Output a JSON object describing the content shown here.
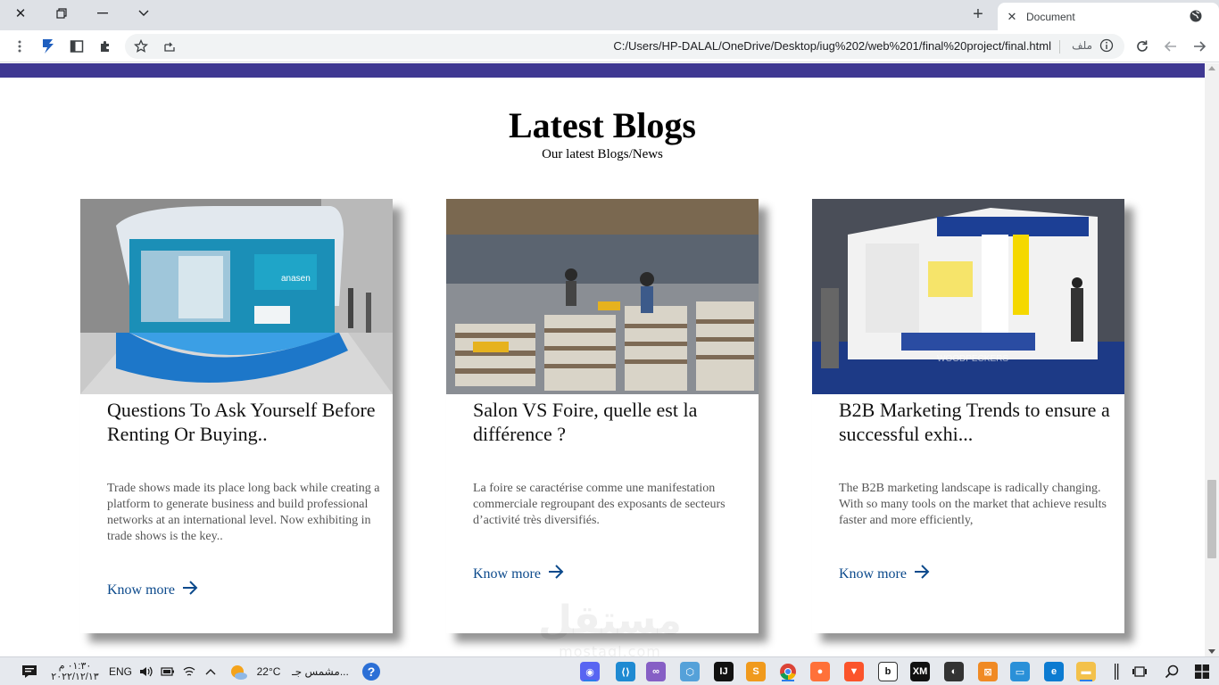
{
  "browser": {
    "tab_title": "Document",
    "tab_close": "✕",
    "new_tab": "+",
    "url": "C:/Users/HP-DALAL/OneDrive/Desktop/iug%202/web%201/final%20project/final.html",
    "file_label": "ملف"
  },
  "section": {
    "title": "Latest Blogs",
    "subtitle": "Our latest Blogs/News"
  },
  "cards": [
    {
      "title": "Questions To Ask Yourself Before Renting Or Buying..",
      "excerpt": "Trade shows made its place long back while creating a platform to generate business and build professional networks at an international level. Now exhibiting in trade shows is the key..",
      "link": "Know more"
    },
    {
      "title": "Salon VS Foire, quelle est la différence ?",
      "excerpt": "La foire se caractérise comme une manifestation commerciale regroupant des exposants de secteurs d’activité très diversifiés.",
      "link": "Know more"
    },
    {
      "title": "B2B Marketing Trends to ensure a successful exhi...",
      "excerpt": "The B2B marketing landscape is radically changing. With so many tools on the market that achieve results faster and more efficiently,",
      "link": "Know more"
    }
  ],
  "watermark": {
    "arabic": "مستقل",
    "latin": "mostaql.com"
  },
  "taskbar": {
    "time": "٠١:٣٠ م",
    "date": "٢٠٢٢/١٢/١٣",
    "lang": "ENG",
    "temperature": "22°C",
    "weather": "مشمس جـ..."
  },
  "colors": {
    "accent_bar": "#3f3892",
    "link": "#0c4a8c"
  }
}
